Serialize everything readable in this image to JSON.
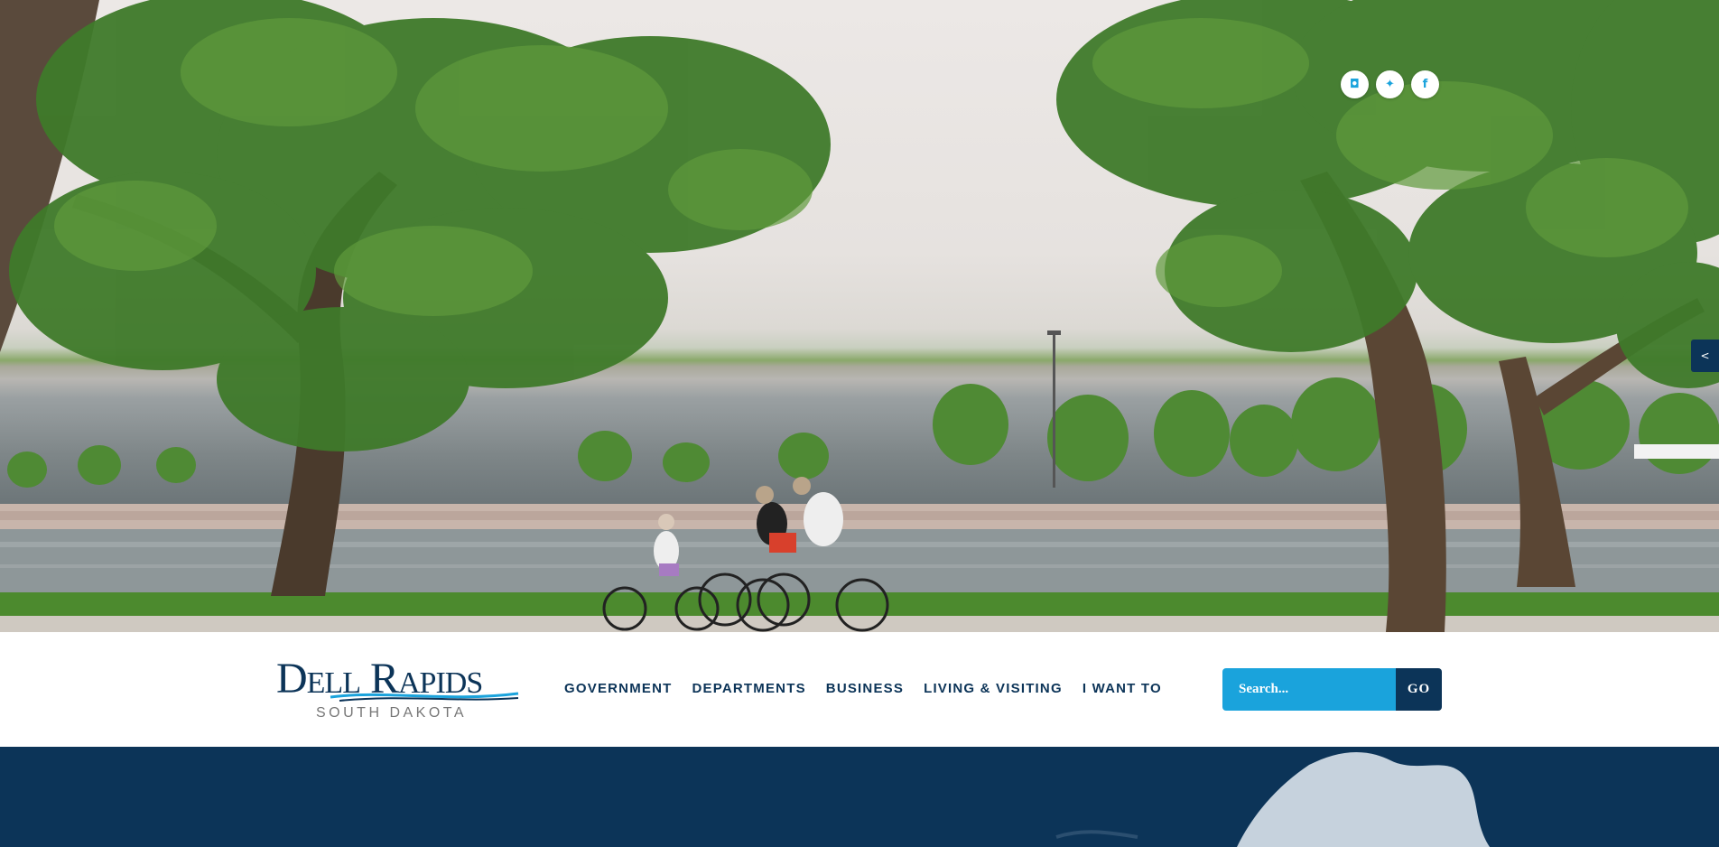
{
  "hero": {
    "image_alt": "Family riding bicycles along the river path under large trees"
  },
  "social": [
    {
      "name": "instagram-icon",
      "glyph": "◘"
    },
    {
      "name": "twitter-icon",
      "glyph": "✦"
    },
    {
      "name": "facebook-icon",
      "glyph": "f"
    }
  ],
  "share_tab": {
    "glyph": "<"
  },
  "logo": {
    "main": "Dell Rapids",
    "sub": "SOUTH DAKOTA"
  },
  "nav": {
    "items": [
      {
        "label": "GOVERNMENT"
      },
      {
        "label": "DEPARTMENTS"
      },
      {
        "label": "BUSINESS"
      },
      {
        "label": "LIVING & VISITING"
      },
      {
        "label": "I WANT TO"
      }
    ]
  },
  "search": {
    "placeholder": "Search...",
    "button_label": "GO"
  },
  "colors": {
    "navy": "#0c3458",
    "accent_blue": "#1aa3dc"
  }
}
